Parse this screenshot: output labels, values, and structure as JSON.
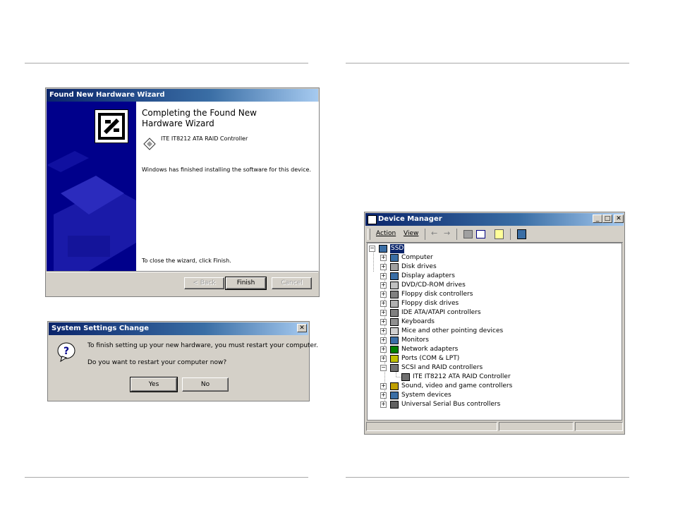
{
  "wizard": {
    "title": "Found New Hardware Wizard",
    "heading_line1": "Completing the Found New",
    "heading_line2": "Hardware Wizard",
    "device_name": "ITE IT8212 ATA RAID Controller",
    "finished_message": "Windows has finished installing the software for this device.",
    "close_instruction": "To close the wizard, click Finish.",
    "back_label": "< Back",
    "finish_label": "Finish",
    "cancel_label": "Cancel",
    "banner_color": "#00008b"
  },
  "restart_dialog": {
    "title": "System Settings Change",
    "message_line1": "To finish setting up your new hardware, you must restart your computer.",
    "message_line2": "Do you want to restart your computer now?",
    "yes_label": "Yes",
    "no_label": "No",
    "close_glyph": "✕",
    "question_glyph": "?"
  },
  "device_manager": {
    "title": "Device Manager",
    "menu_action": "Action",
    "menu_view": "View",
    "minimize_glyph": "_",
    "maximize_glyph": "□",
    "close_glyph": "✕",
    "root_label": "SSD",
    "tree_items": [
      {
        "label": "Computer",
        "icon": "computer-icon",
        "expanded": false
      },
      {
        "label": "Disk drives",
        "icon": "disk-drive-icon",
        "expanded": false
      },
      {
        "label": "Display adapters",
        "icon": "monitor-icon",
        "expanded": false
      },
      {
        "label": "DVD/CD-ROM drives",
        "icon": "cdrom-icon",
        "expanded": false
      },
      {
        "label": "Floppy disk controllers",
        "icon": "controller-icon",
        "expanded": false
      },
      {
        "label": "Floppy disk drives",
        "icon": "floppy-icon",
        "expanded": false
      },
      {
        "label": "IDE ATA/ATAPI controllers",
        "icon": "controller-icon",
        "expanded": false
      },
      {
        "label": "Keyboards",
        "icon": "keyboard-icon",
        "expanded": false
      },
      {
        "label": "Mice and other pointing devices",
        "icon": "mouse-icon",
        "expanded": false
      },
      {
        "label": "Monitors",
        "icon": "monitor-icon",
        "expanded": false
      },
      {
        "label": "Network adapters",
        "icon": "network-icon",
        "expanded": false
      },
      {
        "label": "Ports (COM & LPT)",
        "icon": "port-icon",
        "expanded": false
      },
      {
        "label": "SCSI and RAID controllers",
        "icon": "scsi-icon",
        "expanded": true
      },
      {
        "label": "ITE IT8212 ATA RAID Controller",
        "icon": "scsi-icon",
        "child": true
      },
      {
        "label": "Sound, video and game controllers",
        "icon": "sound-icon",
        "expanded": false
      },
      {
        "label": "System devices",
        "icon": "computer-icon",
        "expanded": false
      },
      {
        "label": "Universal Serial Bus controllers",
        "icon": "usb-icon",
        "expanded": false
      }
    ]
  }
}
